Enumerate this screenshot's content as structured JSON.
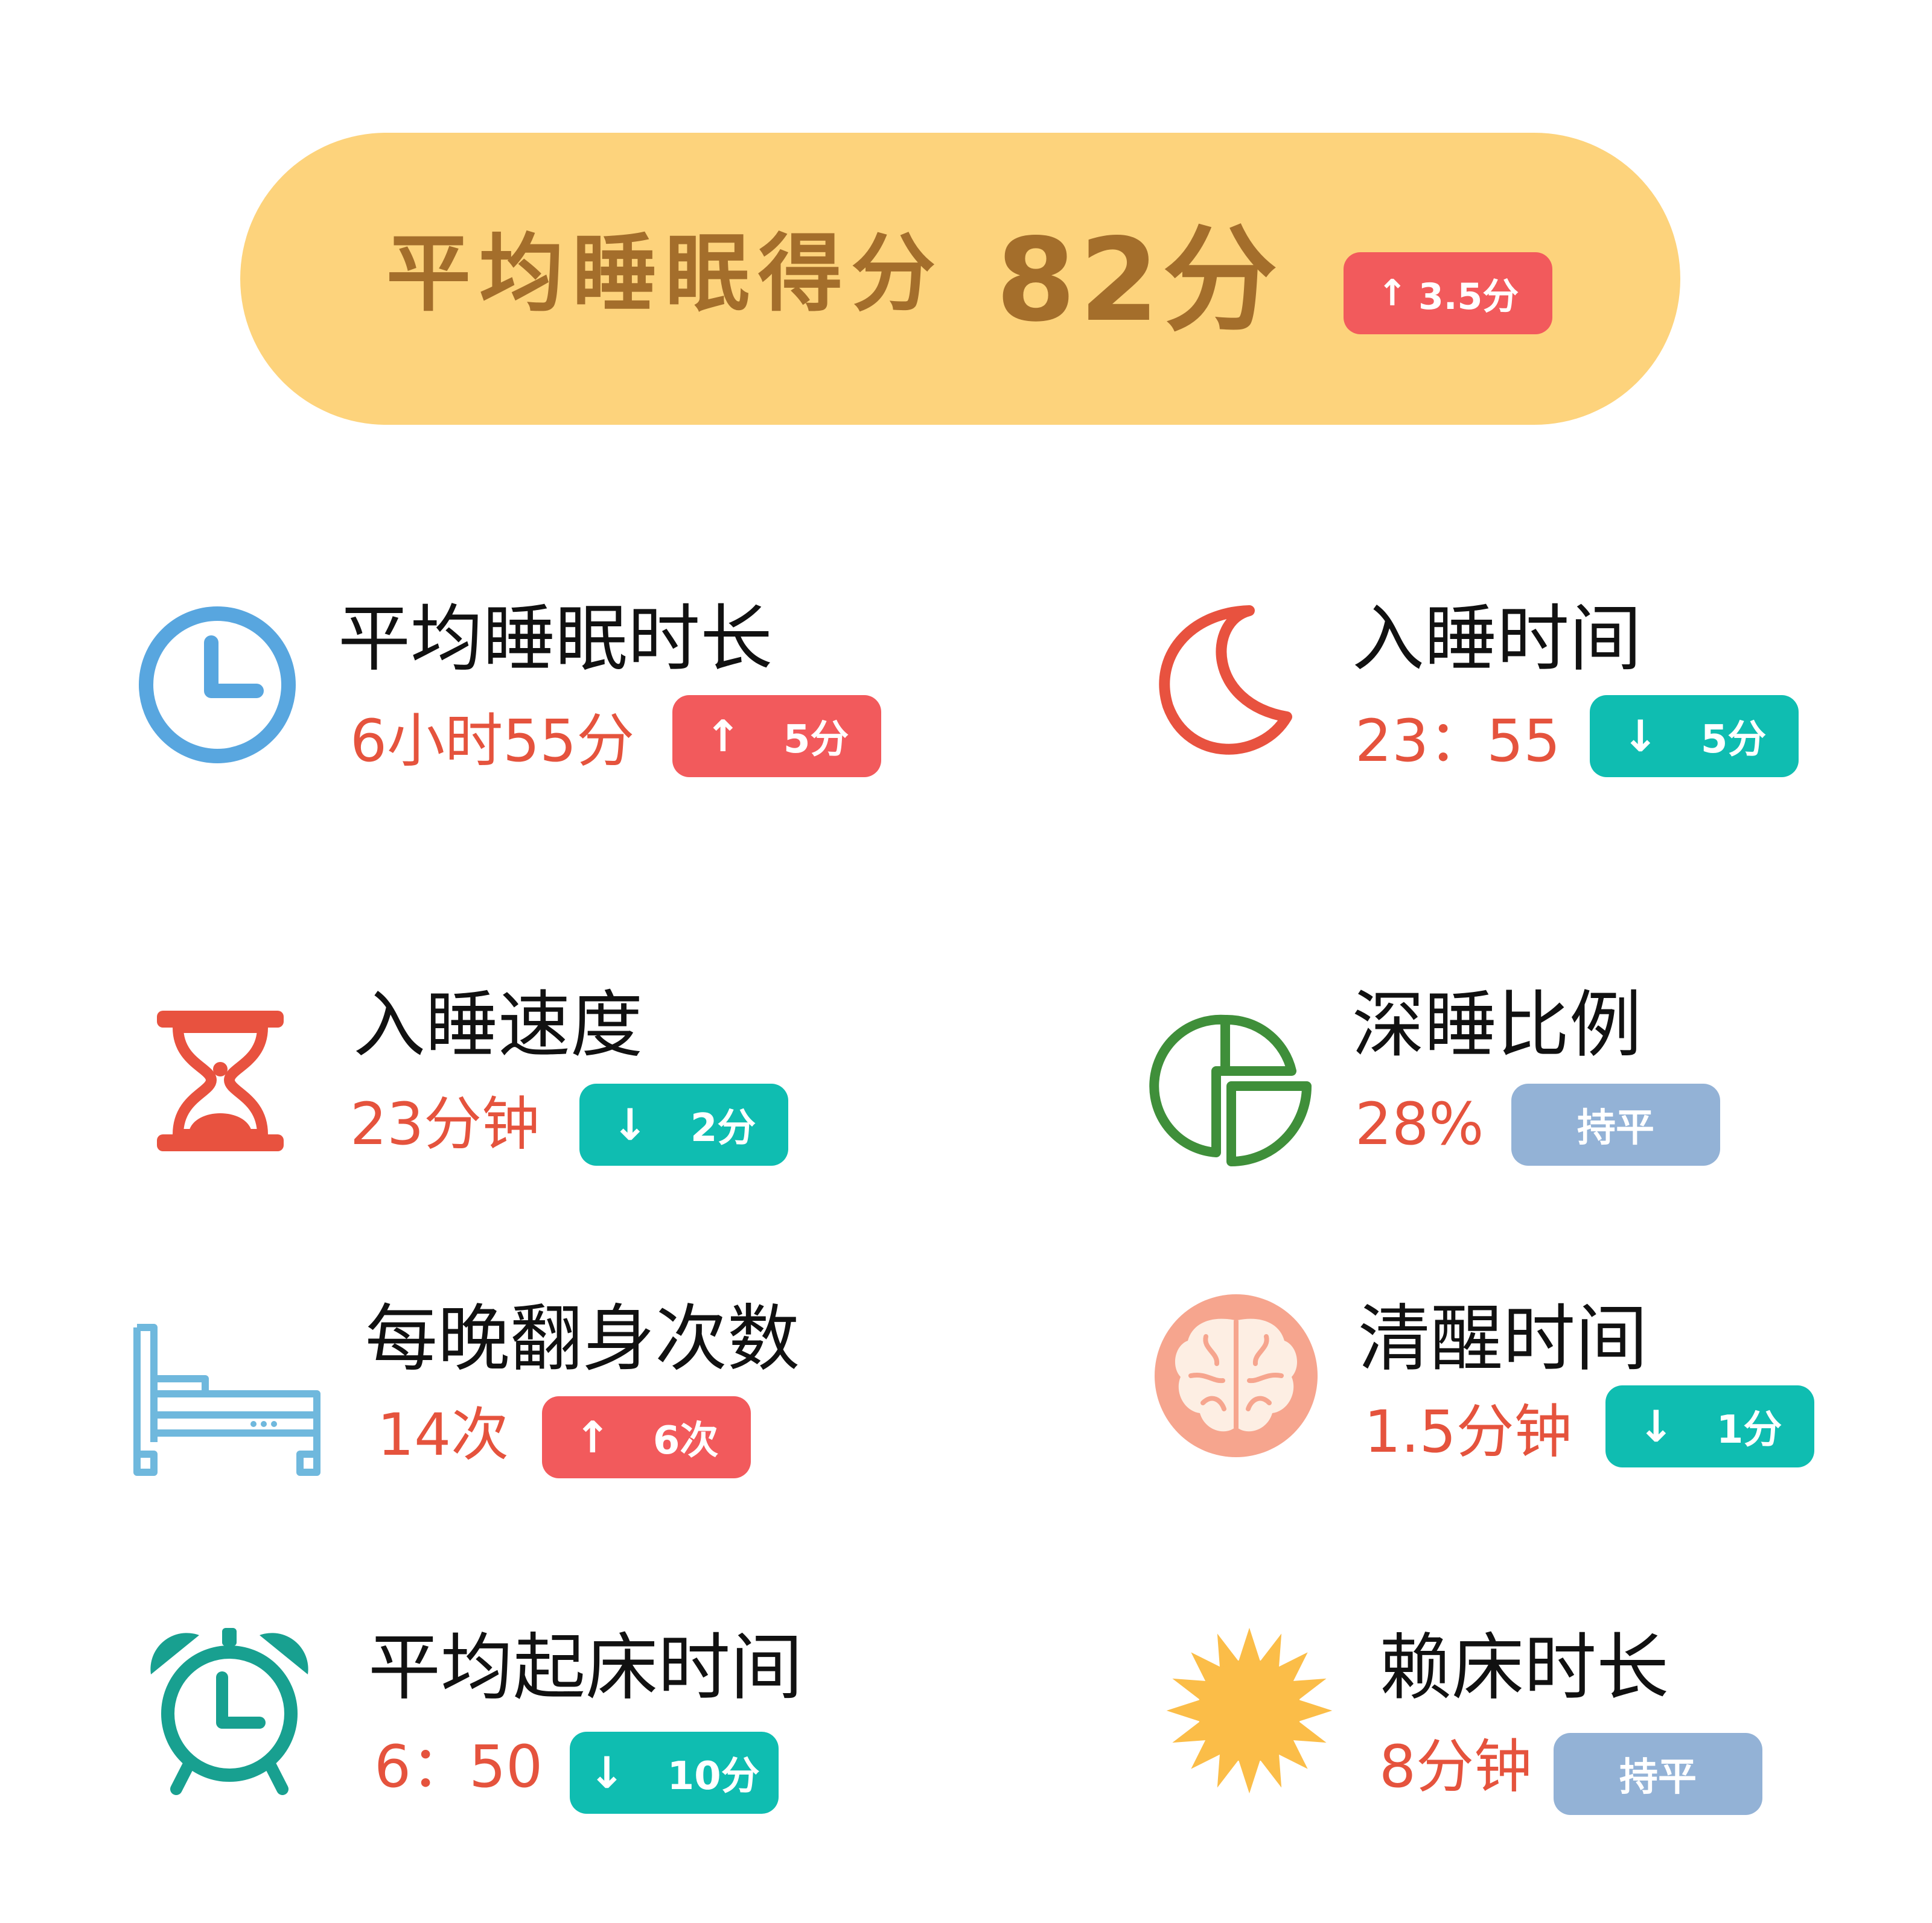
{
  "header": {
    "title": "平均睡眠得分",
    "score": "82分",
    "change": {
      "arrow": "↑",
      "text": "3.5分"
    }
  },
  "metrics": [
    {
      "title": "平均睡眠时长",
      "value": "6小时55分",
      "icon": "clock-icon",
      "badge": {
        "arrow": "↑",
        "text": "5分",
        "trend": "up"
      }
    },
    {
      "title": "入睡时间",
      "value": "23：55",
      "icon": "moon-icon",
      "badge": {
        "arrow": "↓",
        "text": "5分",
        "trend": "down"
      }
    },
    {
      "title": "入睡速度",
      "value": "23分钟",
      "icon": "hourglass-icon",
      "badge": {
        "arrow": "↓",
        "text": "2分",
        "trend": "down"
      }
    },
    {
      "title": "深睡比例",
      "value": "28%",
      "icon": "pie-chart-icon",
      "badge": {
        "arrow": "",
        "text": "持平",
        "trend": "flat"
      }
    },
    {
      "title": "每晚翻身次数",
      "value": "14次",
      "icon": "bed-icon",
      "badge": {
        "arrow": "↑",
        "text": "6次",
        "trend": "up"
      }
    },
    {
      "title": "清醒时间",
      "value": "1.5分钟",
      "icon": "brain-icon",
      "badge": {
        "arrow": "↓",
        "text": "1分",
        "trend": "down"
      }
    },
    {
      "title": "平均起床时间",
      "value": "6：50",
      "icon": "alarm-clock-icon",
      "badge": {
        "arrow": "↓",
        "text": "10分",
        "trend": "down"
      }
    },
    {
      "title": "赖床时长",
      "value": "8分钟",
      "icon": "sun-icon",
      "badge": {
        "arrow": "",
        "text": "持平",
        "trend": "flat"
      }
    }
  ],
  "colors": {
    "header_bg": "#fdd37c",
    "header_text": "#a46e2b",
    "value_text": "#e5533d",
    "badge_up": "#f25a5c",
    "badge_down": "#0fbdb1",
    "badge_flat": "#93b2d6"
  }
}
